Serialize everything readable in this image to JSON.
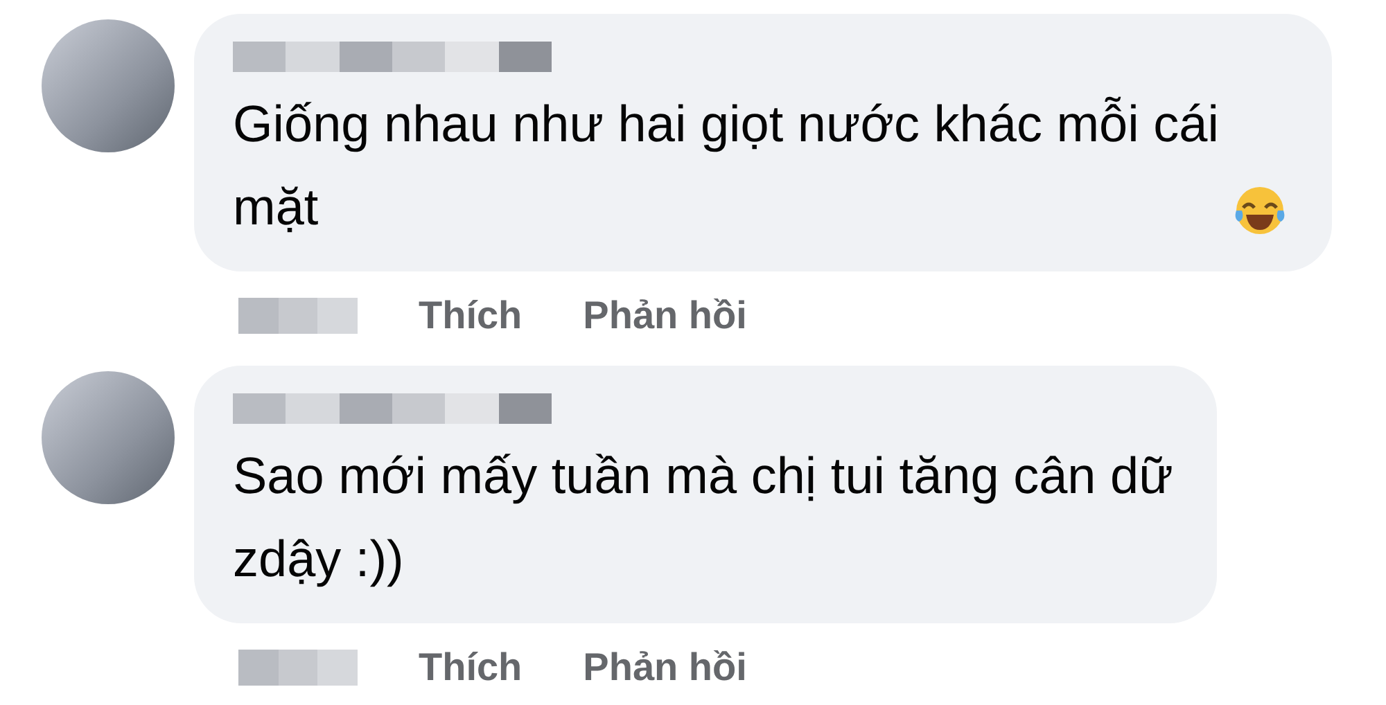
{
  "comments": [
    {
      "text": "Giống nhau như hai giọt nước khác mỗi cái\nmặt",
      "emoji": true,
      "actions": [
        "Thích",
        "Phản hồi"
      ]
    },
    {
      "text": "Sao mới mấy tuần mà chị tui tăng cân dữ\nzdậy :))",
      "emoji": false,
      "actions": [
        "Thích",
        "Phản hồi"
      ]
    }
  ]
}
